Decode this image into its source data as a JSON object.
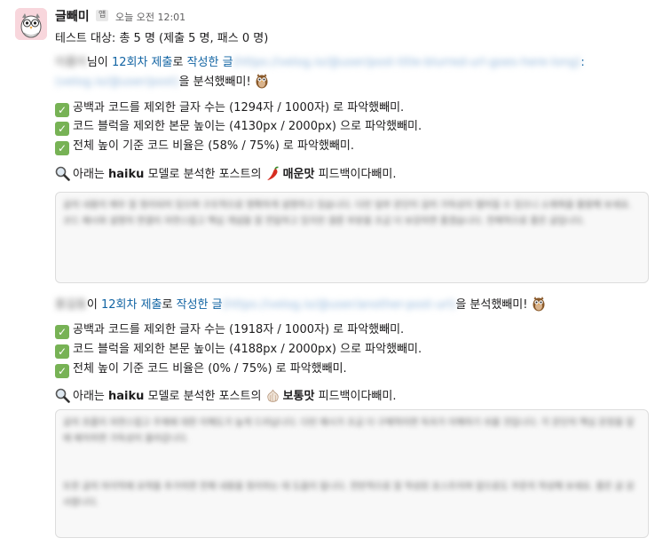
{
  "message": {
    "sender": "글빼미",
    "app_tag": "앱",
    "timestamp": "오늘 오전 12:01",
    "summary": "테스트 대상: 총 5 명 (제출 5 명, 패스 0 명)"
  },
  "submissions": [
    {
      "name_blur": "이름이",
      "name_suffix": "님이",
      "round_link": "12회차 제출",
      "ro": "로",
      "post_link": "작성한 글",
      "post_url_blur": "(https://velog.io/@user/post-title-blurred-url-goes-here-long)",
      "post_url_blur2": "(velog.io/@user/post)",
      "analyzed": "을 분석했빼미!",
      "checks": [
        "공백과 코드를 제외한 글자 수는 (1294자 / 1000자) 로 파악했빼미.",
        "코드 블럭을 제외한 본문 높이는 (4130px / 2000px) 으로 파악했빼미.",
        "전체 높이 기준 코드 비율은 (58% / 75%) 로 파악했빼미."
      ],
      "feedback_pre": "아래는",
      "model": "haiku",
      "feedback_mid": "모델로 분석한 포스트의",
      "taste": "매운맛",
      "taste_icon": "chili-pepper-icon",
      "feedback_post": "피드백이다빼미.",
      "feedback_blur": "글의 내용이 매우 잘 정리되어 있으며 구조적으로 명확하게 설명하고 있습니다. 다만 일부 문단이 길어 가독성이 떨어질 수 있으니 소제목을 활용해 보세요. 코드 예시와 설명의 연결이 자연스럽고 핵심 개념을 잘 전달하고 있지만 결론 부분을 조금 더 보강하면 좋겠습니다. 전체적으로 좋은 글입니다."
    },
    {
      "name_blur": "홍길동",
      "name_suffix": "이",
      "round_link": "12회차 제출",
      "ro": "로",
      "post_link": "작성한 글",
      "post_url_blur": "(https://velog.io/@user/another-post-url)",
      "analyzed": "을 분석했빼미!",
      "checks": [
        "공백과 코드를 제외한 글자 수는 (1918자 / 1000자) 로 파악했빼미.",
        "코드 블럭을 제외한 본문 높이는 (4188px / 2000px) 으로 파악했빼미.",
        "전체 높이 기준 코드 비율은 (0% / 75%) 로 파악했빼미."
      ],
      "feedback_pre": "아래는",
      "model": "haiku",
      "feedback_mid": "모델로 분석한 포스트의",
      "taste": "보통맛",
      "taste_icon": "garlic-icon",
      "feedback_post": "피드백이다빼미.",
      "feedback_blur": "글의 흐름이 자연스럽고 주제에 대한 이해도가 높게 드러납니다. 다만 예시가 조금 더 구체적이면 독자가 이해하기 쉬울 것입니다. 각 문단의 핵심 문장을 앞에 배치하면 가독성이 올라갑니다.",
      "feedback_blur2": "또한 글의 마지막에 요약을 추가하면 전체 내용을 정리하는 데 도움이 됩니다. 전반적으로 잘 작성된 포스트이며 앞으로도 꾸준히 작성해 보세요. 좋은 글 감사합니다."
    }
  ],
  "icons": {
    "avatar": "owl-avatar-icon",
    "owl": "owl-icon",
    "check": "check-mark-icon",
    "search": "magnifying-glass-icon"
  },
  "colors": {
    "link": "#1264a3",
    "check": "#77b255",
    "avatar_bg": "#f8d6dc"
  }
}
